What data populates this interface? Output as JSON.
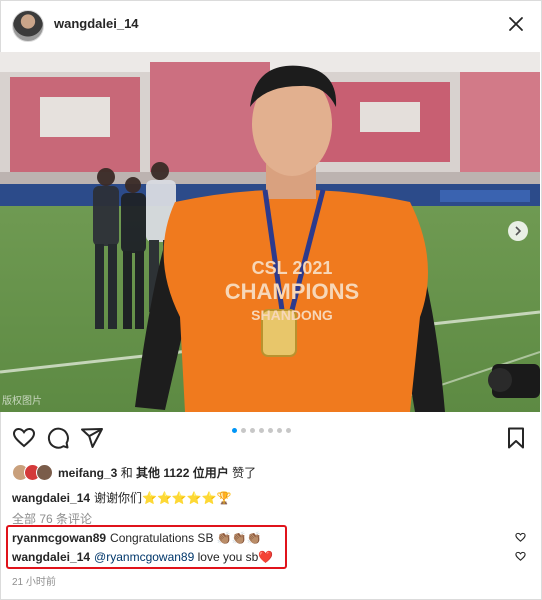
{
  "post": {
    "username": "wangdalei_14",
    "watermark": "版权图片",
    "jersey_line1": "CSL 2021",
    "jersey_line2": "CHAMPIONS",
    "jersey_line3": "SHANDONG",
    "carousel": {
      "dot_count": 7,
      "active_index": 0
    }
  },
  "likes": {
    "user": "meifang_3",
    "and_text": " 和 ",
    "others": "其他 1122 位用户",
    "liked_text": " 赞了"
  },
  "caption": {
    "username": "wangdalei_14",
    "text": "谢谢你们⭐⭐⭐⭐⭐🏆"
  },
  "view_all_comments": "全部 76 条评论",
  "comments": [
    {
      "username": "ryanmcgowan89",
      "text": "Congratulations SB 👏🏽👏🏽👏🏽"
    },
    {
      "username": "wangdalei_14",
      "mention": "@ryanmcgowan89",
      "text": " love you sb❤️"
    }
  ],
  "timestamp": "21 小时前",
  "colors": {
    "highlight_border": "#e0131b",
    "accent_dot": "#0095f6",
    "jersey_orange": "#f07a1e"
  },
  "icons": [
    "more-icon",
    "heart-icon",
    "comment-icon",
    "share-icon",
    "bookmark-icon",
    "chevron-right-icon"
  ]
}
